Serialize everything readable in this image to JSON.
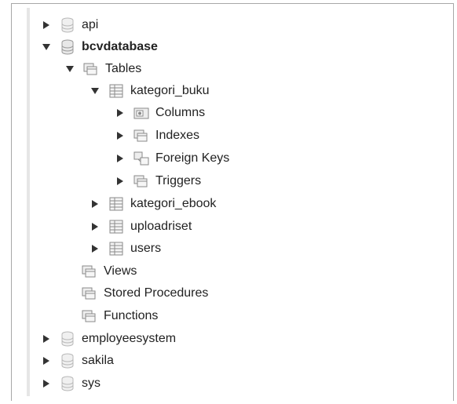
{
  "tree": {
    "db_api": "api",
    "db_bcvdatabase": "bcvdatabase",
    "tables_group": "Tables",
    "table_kategori_buku": "kategori_buku",
    "columns": "Columns",
    "indexes": "Indexes",
    "foreign_keys": "Foreign Keys",
    "triggers": "Triggers",
    "table_kategori_ebook": "kategori_ebook",
    "table_uploadriset": "uploadriset",
    "table_users": "users",
    "views": "Views",
    "stored_procedures": "Stored Procedures",
    "functions": "Functions",
    "db_employeesystem": "employeesystem",
    "db_sakila": "sakila",
    "db_sys": "sys"
  },
  "icons": {
    "database": "database-icon",
    "database_bold": "database-icon",
    "folder": "folder-icon",
    "table": "table-icon",
    "columns": "columns-icon",
    "foreign_keys": "foreign-keys-icon"
  },
  "colors": {
    "text": "#222222",
    "arrow": "#333333",
    "icon_gray": "#b8b8b8",
    "frame": "#a8a8a8"
  }
}
